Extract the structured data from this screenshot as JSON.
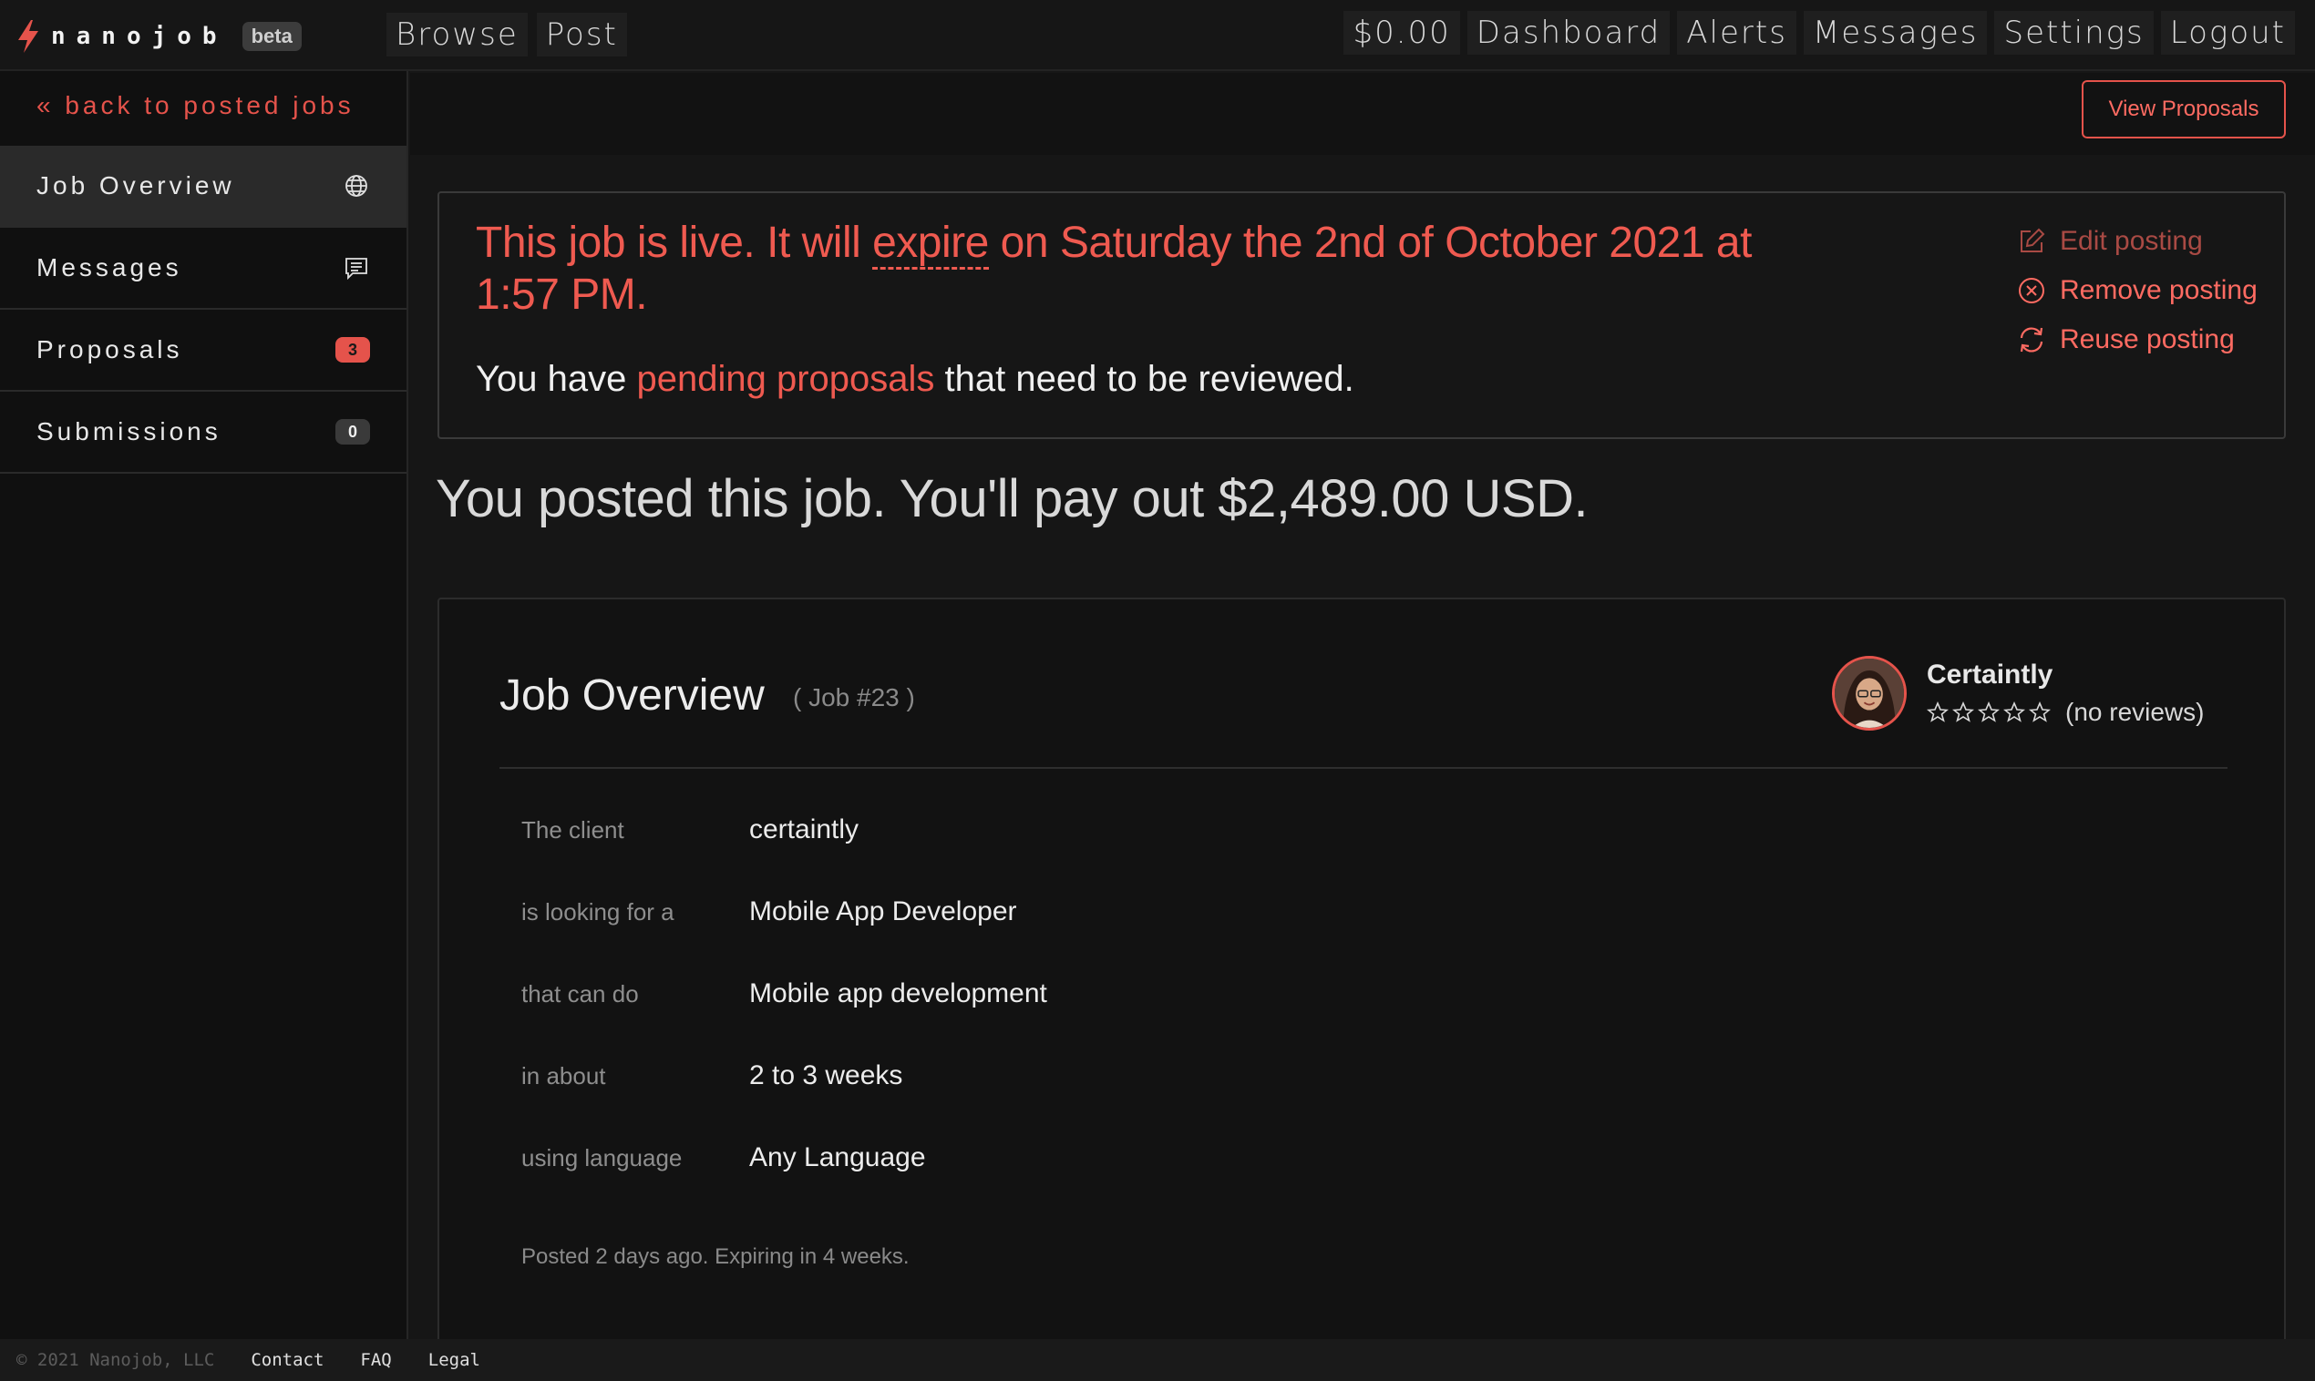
{
  "brand": {
    "name": "nanojob",
    "badge": "beta",
    "accent": "#e5534b"
  },
  "nav": {
    "left": [
      "Browse",
      "Post"
    ],
    "right": [
      "$0.00",
      "Dashboard",
      "Alerts",
      "Messages",
      "Settings",
      "Logout"
    ]
  },
  "sidebar": {
    "back": "« back to posted jobs",
    "items": [
      {
        "label": "Job Overview",
        "icon": "globe-icon",
        "active": true
      },
      {
        "label": "Messages",
        "icon": "message-icon"
      },
      {
        "label": "Proposals",
        "badge": "3"
      },
      {
        "label": "Submissions",
        "badge": "0"
      }
    ]
  },
  "header": {
    "view_proposals": "View Proposals"
  },
  "notice": {
    "title_prefix": "This job is live. It will ",
    "title_link": "expire",
    "title_suffix": " on Saturday the 2nd of October 2021 at 1:57 PM.",
    "sub_prefix": "You have ",
    "sub_link": "pending proposals",
    "sub_suffix": " that need to be reviewed.",
    "actions": [
      "Edit posting",
      "Remove posting",
      "Reuse posting"
    ]
  },
  "payout": "You posted this job. You'll pay out $2,489.00 USD.",
  "overview": {
    "title": "Job Overview",
    "job_number": "( Job #23 )",
    "poster": {
      "name": "Certaintly",
      "stars": 0,
      "reviews": "(no reviews)"
    },
    "rows": [
      {
        "label": "The client",
        "value": "certaintly"
      },
      {
        "label": "is looking for a",
        "value": "Mobile App Developer"
      },
      {
        "label": "that can do",
        "value": "Mobile app development"
      },
      {
        "label": "in about",
        "value": "2 to 3 weeks"
      },
      {
        "label": "using language",
        "value": "Any Language"
      }
    ],
    "posted": "Posted 2 days ago. Expiring in 4 weeks."
  },
  "footer": {
    "copyright": "© 2021 Nanojob, LLC",
    "links": [
      "Contact",
      "FAQ",
      "Legal"
    ]
  }
}
